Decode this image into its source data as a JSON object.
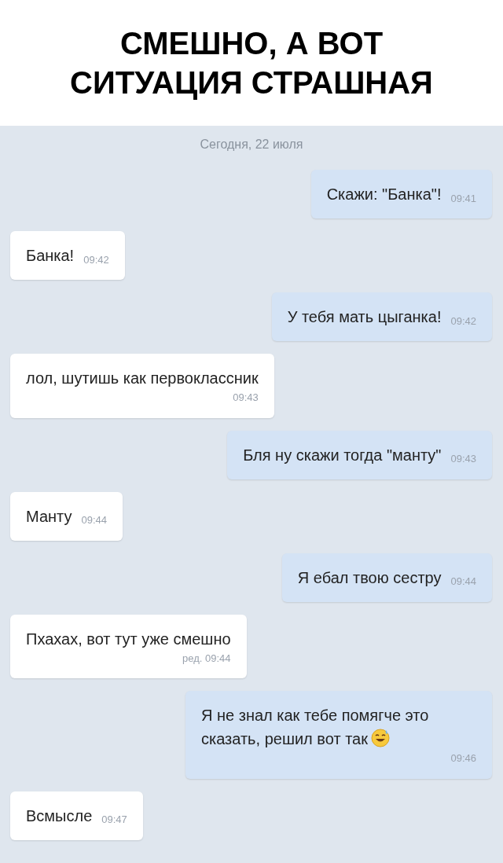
{
  "caption": [
    "СМЕШНО, А ВОТ",
    "СИТУАЦИЯ СТРАШНАЯ"
  ],
  "date": "Сегодня, 22 июля",
  "messages": [
    {
      "kind": "out",
      "text": "Скажи: \"Банка\"!",
      "time": "09:41",
      "time_below": false,
      "emoji": false
    },
    {
      "kind": "in",
      "text": "Банка!",
      "time": "09:42",
      "time_below": false,
      "emoji": false
    },
    {
      "kind": "out",
      "text": "У тебя мать цыганка!",
      "time": "09:42",
      "time_below": false,
      "emoji": false
    },
    {
      "kind": "in",
      "text": "лол, шутишь как первоклассник",
      "time": "09:43",
      "time_below": true,
      "emoji": false
    },
    {
      "kind": "out",
      "text": "Бля ну скажи тогда \"манту\"",
      "time": "09:43",
      "time_below": false,
      "emoji": false
    },
    {
      "kind": "in",
      "text": "Манту",
      "time": "09:44",
      "time_below": false,
      "emoji": false
    },
    {
      "kind": "out",
      "text": "Я ебал твою сестру",
      "time": "09:44",
      "time_below": false,
      "emoji": false
    },
    {
      "kind": "in",
      "text": "Пхахах, вот тут уже смешно",
      "time": "ред. 09:44",
      "time_below": true,
      "emoji": false
    },
    {
      "kind": "out",
      "text": "Я не знал как тебе помягче это сказать, решил вот так",
      "time": "09:46",
      "time_below": true,
      "emoji": true
    },
    {
      "kind": "in",
      "text": "Всмысле",
      "time": "09:47",
      "time_below": false,
      "emoji": false
    }
  ]
}
